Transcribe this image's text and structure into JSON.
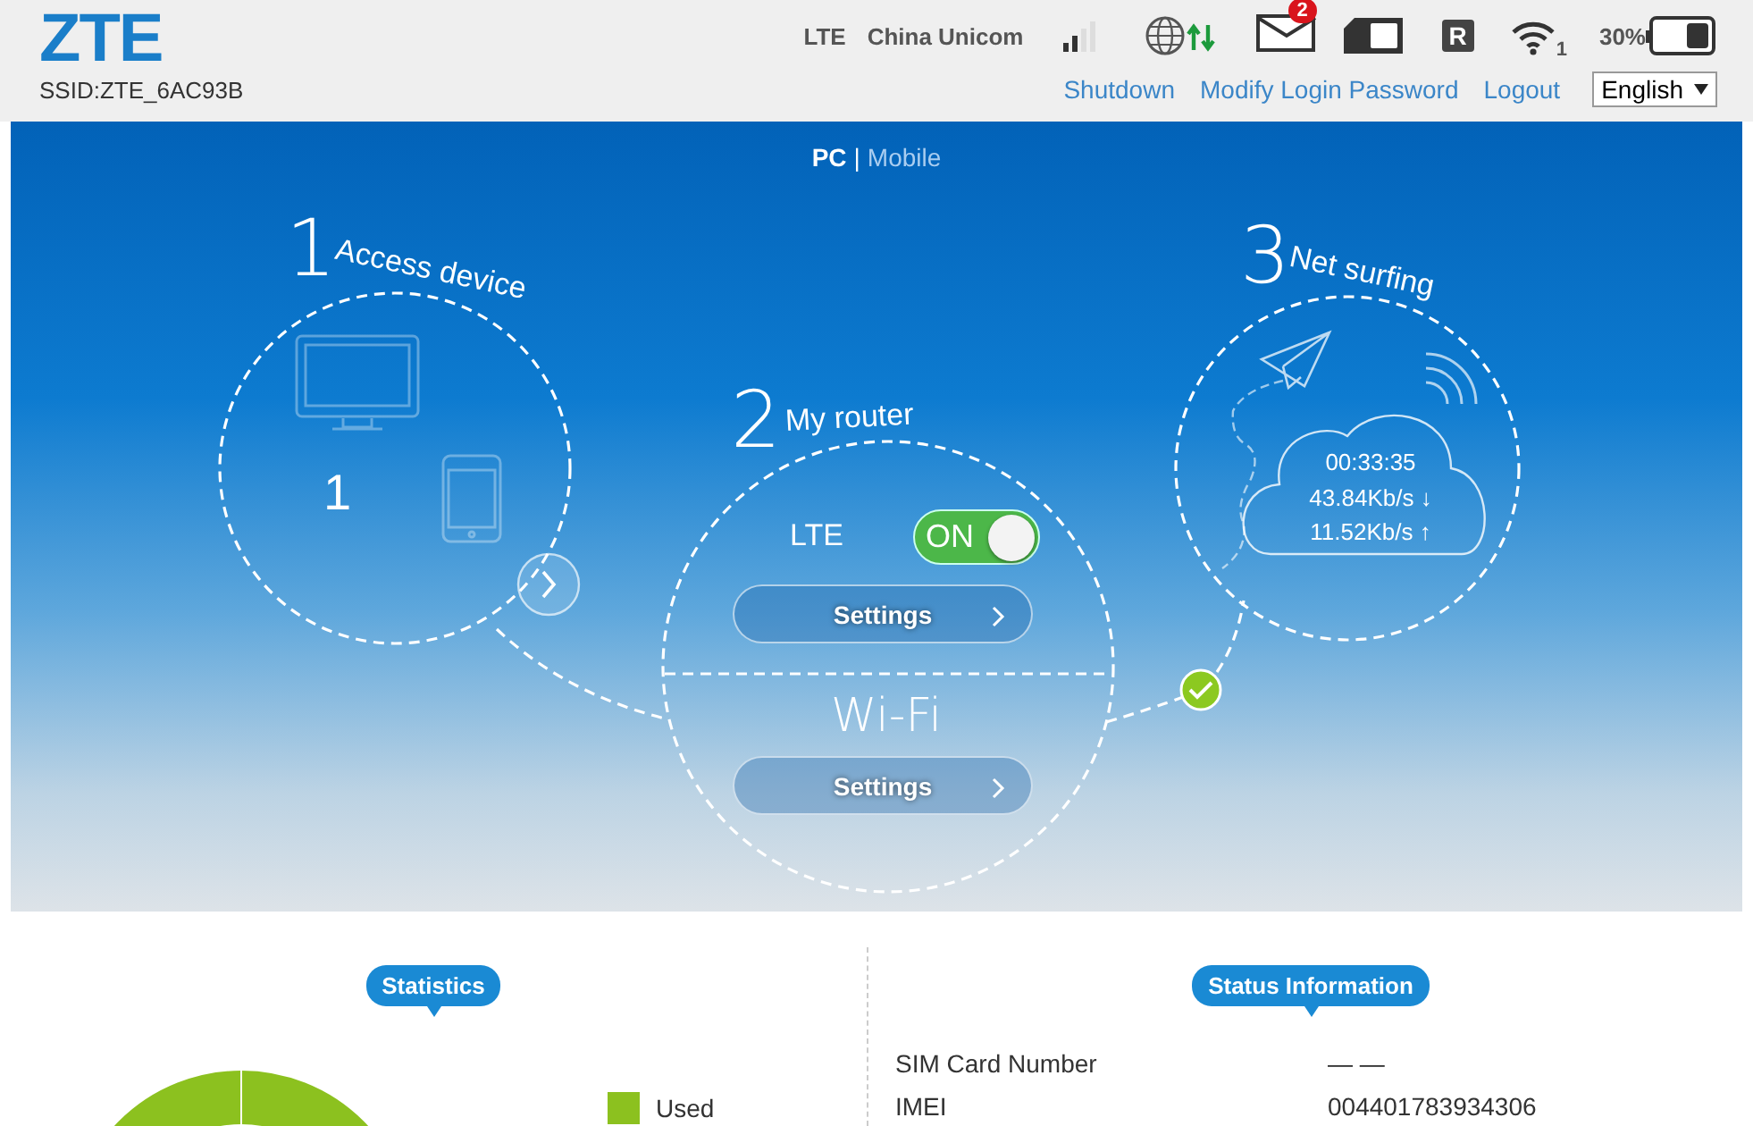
{
  "header": {
    "logo": "ZTE",
    "ssid": "SSID:ZTE_6AC93B",
    "network_type": "LTE",
    "operator": "China Unicom",
    "message_count": "2",
    "roaming": "R",
    "wifi_clients": "1",
    "battery": "30%",
    "links": [
      "Shutdown",
      "Modify Login Password",
      "Logout"
    ],
    "language": "English"
  },
  "view_switch": {
    "options": [
      {
        "label": "PC",
        "selected": true
      },
      {
        "label": "Mobile",
        "selected": false
      }
    ],
    "separator": "|"
  },
  "steps": [
    {
      "kind": "devices",
      "number": "1",
      "title": "Access device",
      "device_count": "1"
    },
    {
      "kind": "router",
      "number": "2",
      "title": "My router",
      "lte_label": "LTE",
      "lte_on": true,
      "toggle_text": "ON",
      "lte_settings": "Settings",
      "wifi_label": "Wi-Fi",
      "wifi_settings": "Settings"
    },
    {
      "kind": "surfing",
      "number": "3",
      "title": "Net surfing",
      "duration": "00:33:35",
      "download": "43.84Kb/s ↓",
      "upload": "11.52Kb/s ↑",
      "connected": true
    }
  ],
  "statistics": {
    "title": "Statistics",
    "legend": [
      {
        "label": "Used",
        "color": "#8cc11f"
      }
    ]
  },
  "status_information": {
    "title": "Status Information",
    "rows": [
      {
        "label": "SIM Card Number",
        "value": "— —"
      },
      {
        "label": "IMEI",
        "value": "004401783934306"
      }
    ]
  }
}
